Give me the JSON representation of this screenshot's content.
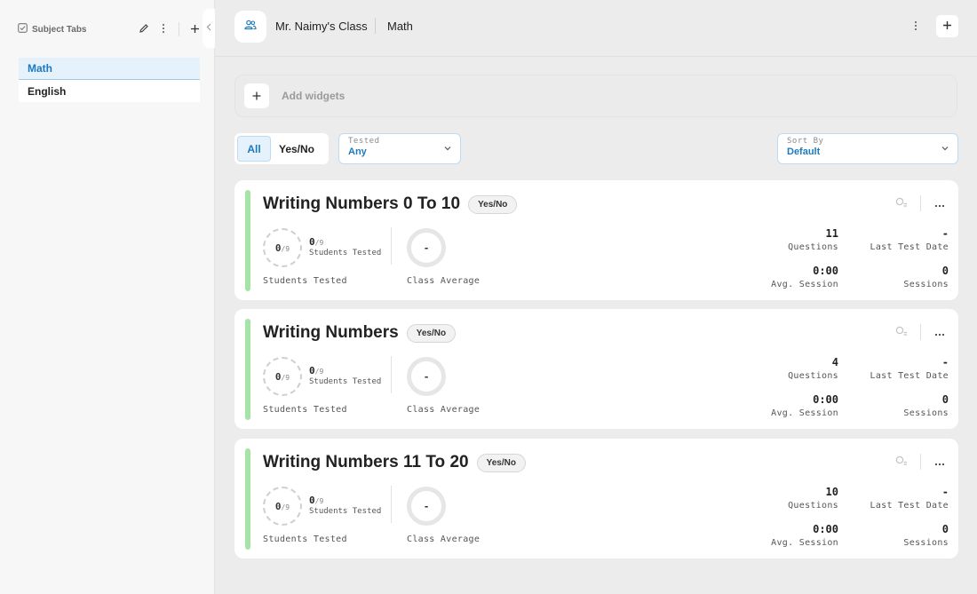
{
  "sidebar": {
    "title": "Subject Tabs",
    "items": [
      {
        "label": "Math",
        "active": true
      },
      {
        "label": "English",
        "active": false
      }
    ]
  },
  "header": {
    "class_name": "Mr. Naimy's Class",
    "subject": "Math"
  },
  "widgets": {
    "label": "Add widgets"
  },
  "filters": {
    "segment": {
      "all": "All",
      "yes_no": "Yes/No"
    },
    "tested": {
      "label": "Tested",
      "value": "Any"
    },
    "sort": {
      "label": "Sort By",
      "value": "Default"
    }
  },
  "cards": [
    {
      "title": "Writing Numbers 0 To 10",
      "badge": "Yes/No",
      "ring_value": "0",
      "ring_total": "/9",
      "tested_value": "0",
      "tested_total": "/9",
      "tested_label": "Students Tested",
      "average_value": "-",
      "students_tested_label": "Students Tested",
      "class_average_label": "Class Average",
      "questions_value": "11",
      "questions_label": "Questions",
      "last_test_value": "-",
      "last_test_label": "Last Test Date",
      "avg_session_value": "0:00",
      "avg_session_label": "Avg. Session",
      "sessions_value": "0",
      "sessions_label": "Sessions"
    },
    {
      "title": "Writing Numbers",
      "badge": "Yes/No",
      "ring_value": "0",
      "ring_total": "/9",
      "tested_value": "0",
      "tested_total": "/9",
      "tested_label": "Students Tested",
      "average_value": "-",
      "students_tested_label": "Students Tested",
      "class_average_label": "Class Average",
      "questions_value": "4",
      "questions_label": "Questions",
      "last_test_value": "-",
      "last_test_label": "Last Test Date",
      "avg_session_value": "0:00",
      "avg_session_label": "Avg. Session",
      "sessions_value": "0",
      "sessions_label": "Sessions"
    },
    {
      "title": "Writing Numbers 11 To 20",
      "badge": "Yes/No",
      "ring_value": "0",
      "ring_total": "/9",
      "tested_value": "0",
      "tested_total": "/9",
      "tested_label": "Students Tested",
      "average_value": "-",
      "students_tested_label": "Students Tested",
      "class_average_label": "Class Average",
      "questions_value": "10",
      "questions_label": "Questions",
      "last_test_value": "-",
      "last_test_label": "Last Test Date",
      "avg_session_value": "0:00",
      "avg_session_label": "Avg. Session",
      "sessions_value": "0",
      "sessions_label": "Sessions"
    }
  ],
  "colors": {
    "accent_blue": "#1d79bd",
    "active_bg": "#e6f2fb",
    "card_accent_green": "#a6e3a6",
    "page_bg": "#ececec"
  },
  "icons": {
    "sidebar_title": "checkbox-icon",
    "edit": "pencil-icon",
    "more": "more-vertical-icon",
    "add": "plus-icon",
    "collapse": "chevron-left-icon",
    "class": "users-icon",
    "card_report": "report-icon",
    "card_more": "more-horizontal-icon"
  }
}
